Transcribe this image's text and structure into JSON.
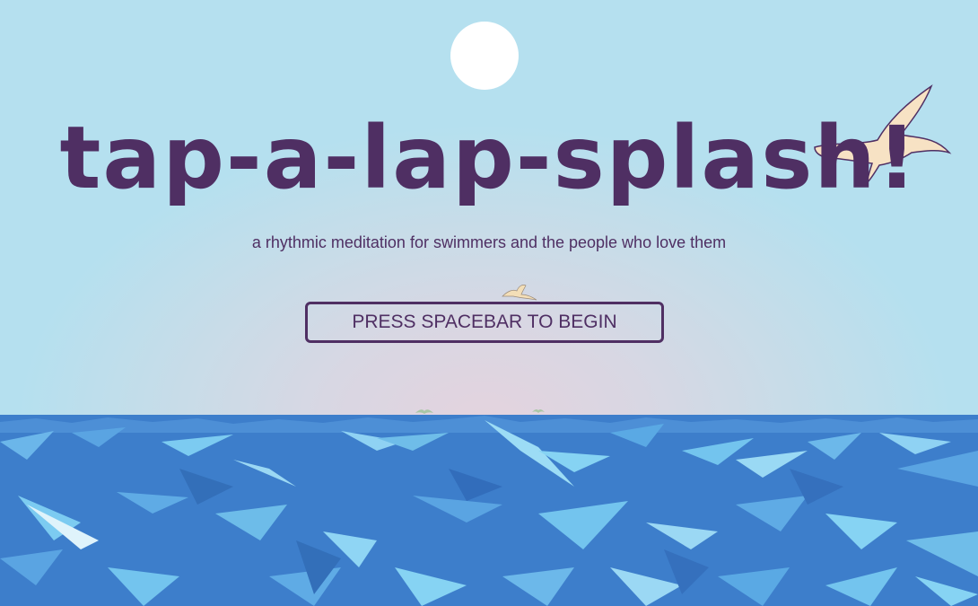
{
  "game": {
    "title": "tap-a-lap-splash!",
    "subtitle": "a rhythmic meditation for swimmers and the people who love them",
    "start_label": "PRESS SPACEBAR TO BEGIN"
  },
  "scene": {
    "sun": "sun",
    "birds": [
      "seagull-icon",
      "seagull-icon",
      "seagull-icon",
      "seagull-icon"
    ],
    "ocean": "low-poly-ocean"
  },
  "colors": {
    "text": "#4f2f63",
    "sky_top": "#b5e0ef",
    "sky_glow": "#e4d3de",
    "sun": "#ffffff",
    "ocean": "#3d7ecb",
    "ocean_light": "#73c4ee",
    "gull": "#f7e2c4"
  }
}
